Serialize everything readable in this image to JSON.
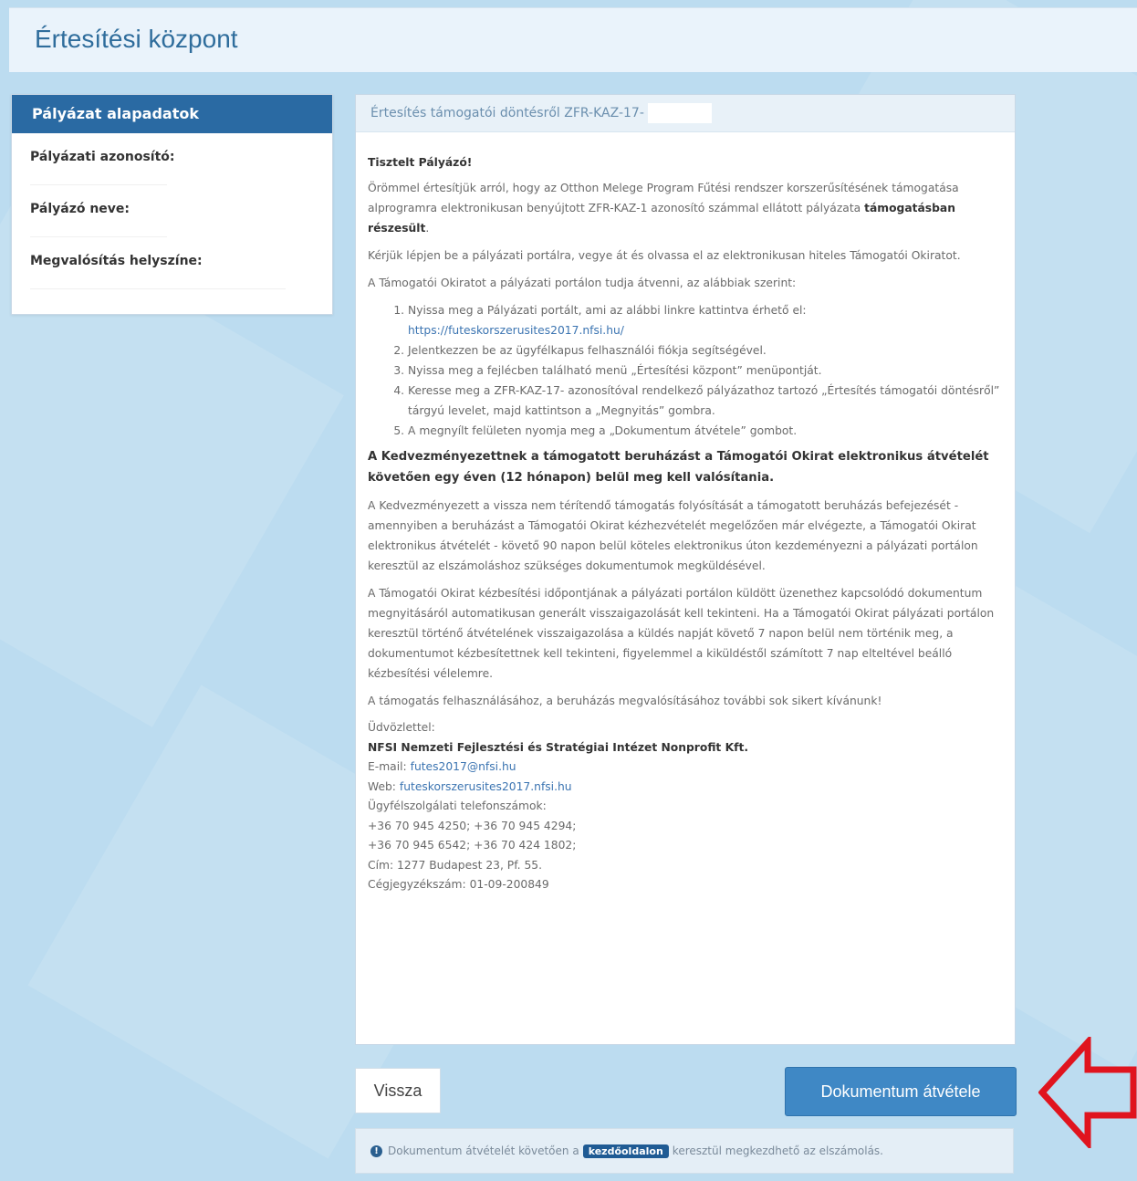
{
  "header": {
    "title": "Értesítési központ"
  },
  "sidebar": {
    "title": "Pályázat alapadatok",
    "fields": [
      {
        "label": "Pályázati azonosító:",
        "value": ""
      },
      {
        "label": "Pályázó neve:",
        "value": ""
      },
      {
        "label": "Megvalósítás helyszíne:",
        "value": ""
      }
    ]
  },
  "message": {
    "subject": "Értesítés támogatói döntésről ZFR-KAZ-17-",
    "greeting": "Tisztelt Pályázó!",
    "p1_a": "Örömmel értesítjük arról, hogy az Otthon Melege Program Fűtési rendszer korszerűsítésének támogatása alprogramra elektronikusan benyújtott ZFR-KAZ-1",
    "p1_b": " azonosító számmal ellátott pályázata ",
    "p1_bold": "támogatásban részesült",
    "p1_end": ".",
    "p2": "Kérjük lépjen be a pályázati portálra, vegye át és olvassa el az elektronikusan hiteles Támogatói Okiratot.",
    "p3": "A Támogatói Okiratot a pályázati portálon tudja átvenni, az alábbiak szerint:",
    "steps": [
      "Nyissa meg a Pályázati portált, ami az alábbi linkre kattintva érhető el:",
      "Jelentkezzen be az ügyfélkapus felhasználói fiókja segítségével.",
      "Nyissa meg a fejlécben található menü „Értesítési központ” menüpontját.",
      "Keresse meg a ZFR-KAZ-17-            azonosítóval rendelkező pályázathoz tartozó „Értesítés támogatói döntésről” tárgyú levelet, majd kattintson a „Megnyitás” gombra.",
      "A megnyílt felületen nyomja meg a „Dokumentum átvétele” gombot."
    ],
    "step1_link": "https://futeskorszerusites2017.nfsi.hu/",
    "bold_notice": "A Kedvezményezettnek a támogatott beruházást a Támogatói Okirat elektronikus átvételét követően egy éven (12 hónapon) belül meg kell valósítania.",
    "p4": "A Kedvezményezett a vissza nem térítendő támogatás folyósítását a támogatott beruházás befejezését - amennyiben a beruházást a Támogatói Okirat kézhezvételét megelőzően már elvégezte, a Támogatói Okirat elektronikus átvételét - követő 90 napon belül köteles elektronikus úton kezdeményezni a pályázati portálon keresztül az elszámoláshoz szükséges dokumentumok megküldésével.",
    "p5": "A Támogatói Okirat kézbesítési időpontjának a pályázati portálon küldött üzenethez kapcsolódó dokumentum megnyitásáról automatikusan generált visszaigazolását kell tekinteni. Ha a Támogatói Okirat pályázati portálon keresztül történő átvételének visszaigazolása a küldés napját követő 7 napon belül nem történik meg, a dokumentumot kézbesítettnek kell tekinteni, figyelemmel a kiküldéstől számított 7 nap elteltével beálló kézbesítési vélelemre.",
    "p6": "A támogatás felhasználásához, a beruházás megvalósításához további sok sikert kívánunk!",
    "signature": {
      "regards": "Üdvözlettel:",
      "org": "NFSI Nemzeti Fejlesztési és Stratégiai Intézet Nonprofit Kft.",
      "email_label": "E-mail: ",
      "email": "futes2017@nfsi.hu",
      "web_label": "Web: ",
      "web": "futeskorszerusites2017.nfsi.hu",
      "phones_label": "Ügyfélszolgálati telefonszámok:",
      "phones1": "+36 70 945 4250; +36 70 945 4294;",
      "phones2": "+36 70 945 6542; +36 70 424 1802;",
      "address": "Cím: 1277 Budapest 23, Pf. 55.",
      "reg": "Cégjegyzékszám: 01-09-200849"
    }
  },
  "buttons": {
    "back": "Vissza",
    "accept": "Dokumentum átvétele"
  },
  "info": {
    "before": "Dokumentum átvételét követően a ",
    "badge": "kezdőoldalon",
    "after": " keresztül megkezdhető az elszámolás."
  },
  "colors": {
    "accent": "#3f88c5",
    "arrow": "#e0141e",
    "header_bar": "#2a6aa3"
  }
}
